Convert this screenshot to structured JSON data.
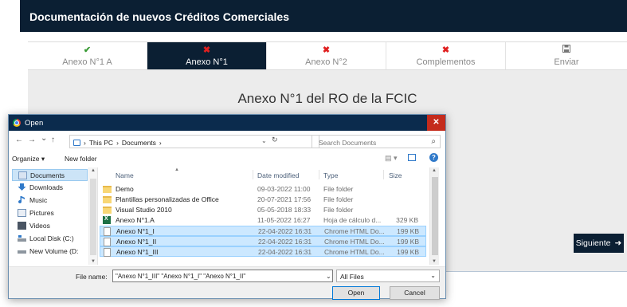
{
  "app": {
    "header_title": "Documentación de nuevos Créditos Comerciales",
    "steps": [
      {
        "label": "Anexo N°1 A",
        "icon": "check-icon",
        "status": "✔"
      },
      {
        "label": "Anexo N°1",
        "icon": "error-icon",
        "status": "✖"
      },
      {
        "label": "Anexo N°2",
        "icon": "error-icon",
        "status": "✖"
      },
      {
        "label": "Complementos",
        "icon": "error-icon",
        "status": "✖"
      },
      {
        "label": "Enviar",
        "icon": "save-icon",
        "status": "▝"
      }
    ],
    "content_title": "Anexo N°1 del RO de la FCIC",
    "next_label": "Siguiente",
    "next_icon": "➜",
    "colors": {
      "header_bg": "#0b1f33",
      "active_step_bg": "#0b1f33",
      "ok": "#3a9b36",
      "error": "#e02020"
    }
  },
  "dialog": {
    "title": "Open",
    "close_glyph": "✕",
    "nav": {
      "back": "←",
      "forward": "→",
      "recent": "⌄",
      "up": "↑"
    },
    "address": {
      "root": "This PC",
      "sep": "›",
      "folder": "Documents",
      "trail": "›",
      "dropdown": "⌄",
      "refresh": "↻"
    },
    "search": {
      "placeholder": "Search Documents",
      "icon": "⌕"
    },
    "toolbar": {
      "organize": "Organize ▾",
      "new_folder": "New folder",
      "view": "▤ ▾",
      "help": "?"
    },
    "sidebar": [
      {
        "label": "Documents",
        "icon": "documents-icon"
      },
      {
        "label": "Downloads",
        "icon": "downloads-icon"
      },
      {
        "label": "Music",
        "icon": "music-icon"
      },
      {
        "label": "Pictures",
        "icon": "pictures-icon"
      },
      {
        "label": "Videos",
        "icon": "videos-icon"
      },
      {
        "label": "Local Disk (C:)",
        "icon": "disk-icon"
      },
      {
        "label": "New Volume (D:",
        "icon": "volume-icon"
      }
    ],
    "columns": {
      "name": "Name",
      "date": "Date modified",
      "type": "Type",
      "size": "Size"
    },
    "files": [
      {
        "name": "Demo",
        "date": "09-03-2022 11:00",
        "type": "File folder",
        "size": "",
        "kind": "folder"
      },
      {
        "name": "Plantillas personalizadas de Office",
        "date": "20-07-2021 17:56",
        "type": "File folder",
        "size": "",
        "kind": "folder"
      },
      {
        "name": "Visual Studio 2010",
        "date": "05-05-2018 18:33",
        "type": "File folder",
        "size": "",
        "kind": "folder"
      },
      {
        "name": "Anexo N°1.A",
        "date": "11-05-2022 16:27",
        "type": "Hoja de cálculo d...",
        "size": "329 KB",
        "kind": "excel"
      },
      {
        "name": "Anexo N°1_I",
        "date": "22-04-2022 16:31",
        "type": "Chrome HTML Do...",
        "size": "199 KB",
        "kind": "html"
      },
      {
        "name": "Anexo N°1_II",
        "date": "22-04-2022 16:31",
        "type": "Chrome HTML Do...",
        "size": "199 KB",
        "kind": "html"
      },
      {
        "name": "Anexo N°1_III",
        "date": "22-04-2022 16:31",
        "type": "Chrome HTML Do...",
        "size": "199 KB",
        "kind": "html"
      }
    ],
    "file_name_label": "File name:",
    "file_name_value": "\"Anexo N°1_III\" \"Anexo N°1_I\" \"Anexo N°1_II\"",
    "file_name_dropdown": "⌄",
    "filter": "All Files",
    "filter_dropdown": "⌄",
    "open_label": "Open",
    "cancel_label": "Cancel"
  }
}
